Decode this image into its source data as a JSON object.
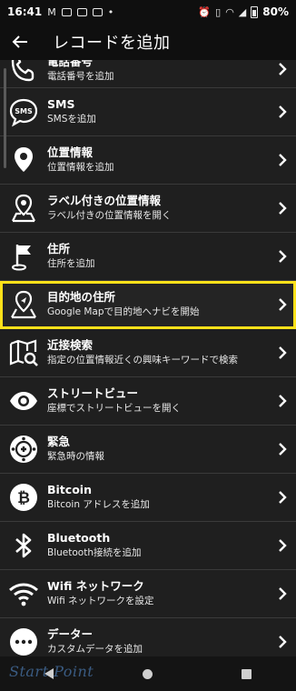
{
  "status_bar": {
    "time": "16:41",
    "battery": "80%"
  },
  "app_bar": {
    "title": "レコードを追加"
  },
  "rows": [
    {
      "title": "電話番号",
      "subtitle": "電話番号を追加",
      "icon": "phone-icon"
    },
    {
      "title": "SMS",
      "subtitle": "SMSを追加",
      "icon": "sms-icon"
    },
    {
      "title": "位置情報",
      "subtitle": "位置情報を追加",
      "icon": "location-pin-icon"
    },
    {
      "title": "ラベル付きの位置情報",
      "subtitle": "ラベル付きの位置情報を開く",
      "icon": "labeled-location-icon"
    },
    {
      "title": "住所",
      "subtitle": "住所を追加",
      "icon": "flag-icon"
    },
    {
      "title": "目的地の住所",
      "subtitle": "Google Mapで目的地へナビを開始",
      "icon": "navigation-icon"
    },
    {
      "title": "近接検索",
      "subtitle": "指定の位置情報近くの興味キーワードで検索",
      "icon": "map-search-icon"
    },
    {
      "title": "ストリートビュー",
      "subtitle": "座標でストリートビューを開く",
      "icon": "eye-icon"
    },
    {
      "title": "緊急",
      "subtitle": "緊急時の情報",
      "icon": "emergency-icon"
    },
    {
      "title": "Bitcoin",
      "subtitle": "Bitcoin アドレスを追加",
      "icon": "bitcoin-icon"
    },
    {
      "title": "Bluetooth",
      "subtitle": "Bluetooth接続を追加",
      "icon": "bluetooth-icon"
    },
    {
      "title": "Wifi ネットワーク",
      "subtitle": "Wifi ネットワークを設定",
      "icon": "wifi-icon"
    },
    {
      "title": "データー",
      "subtitle": "カスタムデータを追加",
      "icon": "data-icon"
    }
  ],
  "highlighted_row": "目的地の住所",
  "watermark": "Start Point",
  "colors": {
    "background": "#1f1f1f",
    "bar": "#0f0f0f",
    "highlight": "#ffe11a"
  }
}
